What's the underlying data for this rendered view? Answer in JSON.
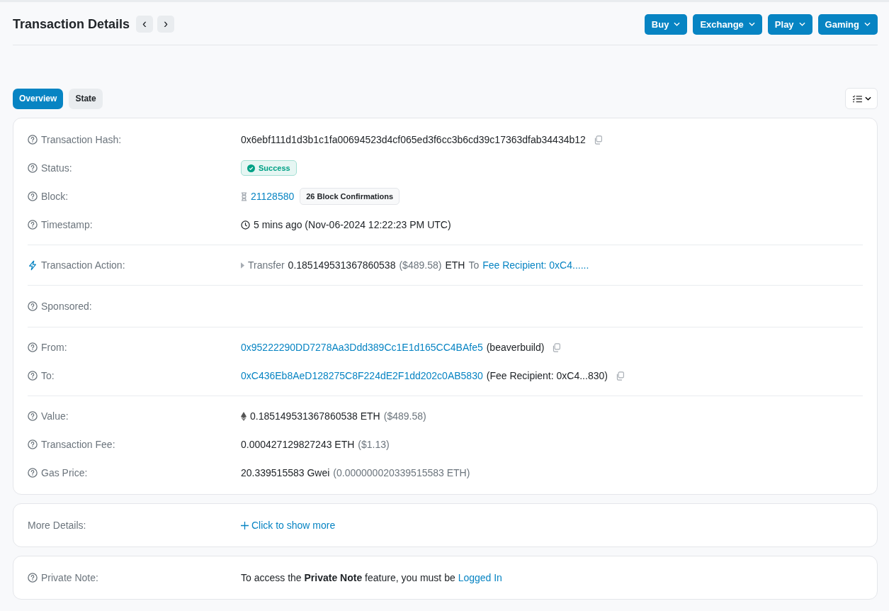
{
  "header": {
    "title": "Transaction Details",
    "nav": [
      "‹",
      "›"
    ],
    "menus": [
      "Buy",
      "Exchange",
      "Play",
      "Gaming"
    ]
  },
  "tabs": [
    {
      "label": "Overview",
      "selected": true
    },
    {
      "label": "State",
      "selected": false
    }
  ],
  "overview": [
    [
      {
        "kind": "hash",
        "label": "Transaction Hash:",
        "parts": [
          {
            "kind": "text",
            "text": "0x6ebf111d1d3b1c1fa00694523d4cf065ed3f6cc3b6cd39c17363dfab34434b12"
          }
        ]
      },
      {
        "kind": "status",
        "label": "Status:",
        "status": "Success"
      },
      {
        "kind": "block",
        "label": "Block:",
        "parts": [
          {
            "kind": "link",
            "text": "21128580"
          },
          {
            "kind": "badge",
            "text": "26 Block Confirmations"
          }
        ]
      },
      {
        "kind": "timestamp",
        "label": "Timestamp:",
        "parts": [
          {
            "kind": "text",
            "text": "5 mins ago (Nov-06-2024 12:22:23 PM UTC)"
          }
        ]
      }
    ],
    [
      {
        "kind": "action",
        "label": "Transaction Action:",
        "parts": [
          {
            "kind": "muted",
            "text": "Transfer"
          },
          {
            "kind": "text",
            "text": "0.185149531367860538"
          },
          {
            "kind": "muted",
            "text": "($489.58)"
          },
          {
            "kind": "text",
            "text": "ETH"
          },
          {
            "kind": "muted",
            "text": "To"
          },
          {
            "kind": "link",
            "text": "Fee Recipient: 0xC4......"
          }
        ]
      }
    ],
    [
      {
        "kind": "plain",
        "label": "Sponsored:"
      }
    ],
    [
      {
        "kind": "address",
        "label": "From:",
        "parts": [
          {
            "kind": "link",
            "text": "0x95222290DD7278Aa3Ddd389Cc1E1d165CC4BAfe5"
          },
          {
            "kind": "text",
            "text": "(beaverbuild)"
          }
        ]
      },
      {
        "kind": "address",
        "label": "To:",
        "parts": [
          {
            "kind": "link",
            "text": "0xC436Eb8AeD128275C8F224dE2F1dd202c0AB5830"
          },
          {
            "kind": "text",
            "text": "(Fee Recipient: 0xC4...830)"
          }
        ]
      }
    ],
    [
      {
        "kind": "value",
        "label": "Value:",
        "parts": [
          {
            "kind": "text",
            "text": "0.185149531367860538 ETH"
          },
          {
            "kind": "muted",
            "text": "($489.58)"
          }
        ]
      },
      {
        "kind": "plain",
        "label": "Transaction Fee:",
        "parts": [
          {
            "kind": "text",
            "text": "0.000427129827243 ETH"
          },
          {
            "kind": "muted",
            "text": "($1.13)"
          }
        ]
      },
      {
        "kind": "plain",
        "label": "Gas Price:",
        "parts": [
          {
            "kind": "text",
            "text": "20.339515583 Gwei"
          },
          {
            "kind": "muted",
            "text": "(0.000000020339515583 ETH)"
          }
        ]
      }
    ]
  ],
  "more_details": {
    "label": "More Details:",
    "link": "Click to show more"
  },
  "private_note": {
    "label": "Private Note:",
    "text": "To access the **Private Note** feature, you must be",
    "link": "Logged In"
  }
}
